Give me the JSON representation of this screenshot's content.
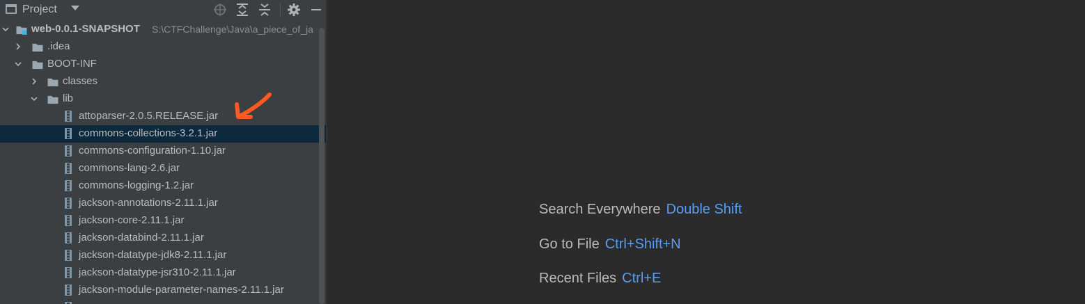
{
  "project_panel": {
    "title": "Project",
    "icons": [
      "project-window-icon",
      "chevron-down-icon",
      "locate-icon",
      "expand-all-icon",
      "collapse-all-icon",
      "gear-icon",
      "minimize-icon"
    ],
    "root": {
      "name": "web-0.0.1-SNAPSHOT",
      "path": "S:\\CTFChallenge\\Java\\a_piece_of_ja"
    },
    "folders": {
      "idea": ".idea",
      "boot_inf": "BOOT-INF",
      "classes": "classes",
      "lib": "lib"
    },
    "jars": [
      "attoparser-2.0.5.RELEASE.jar",
      "commons-collections-3.2.1.jar",
      "commons-configuration-1.10.jar",
      "commons-lang-2.6.jar",
      "commons-logging-1.2.jar",
      "jackson-annotations-2.11.1.jar",
      "jackson-core-2.11.1.jar",
      "jackson-databind-2.11.1.jar",
      "jackson-datatype-jdk8-2.11.1.jar",
      "jackson-datatype-jsr310-2.11.1.jar",
      "jackson-module-parameter-names-2.11.1.jar"
    ],
    "selected_jar": "commons-collections-3.2.1.jar"
  },
  "editor_hints": [
    {
      "label": "Search Everywhere",
      "shortcut": "Double Shift"
    },
    {
      "label": "Go to File",
      "shortcut": "Ctrl+Shift+N"
    },
    {
      "label": "Recent Files",
      "shortcut": "Ctrl+E"
    }
  ],
  "colors": {
    "panel_bg": "#3c3f41",
    "editor_bg": "#2b2b2b",
    "selection": "#0d293e",
    "shortcut": "#589df6",
    "annotation_arrow": "#ff5a1f"
  }
}
